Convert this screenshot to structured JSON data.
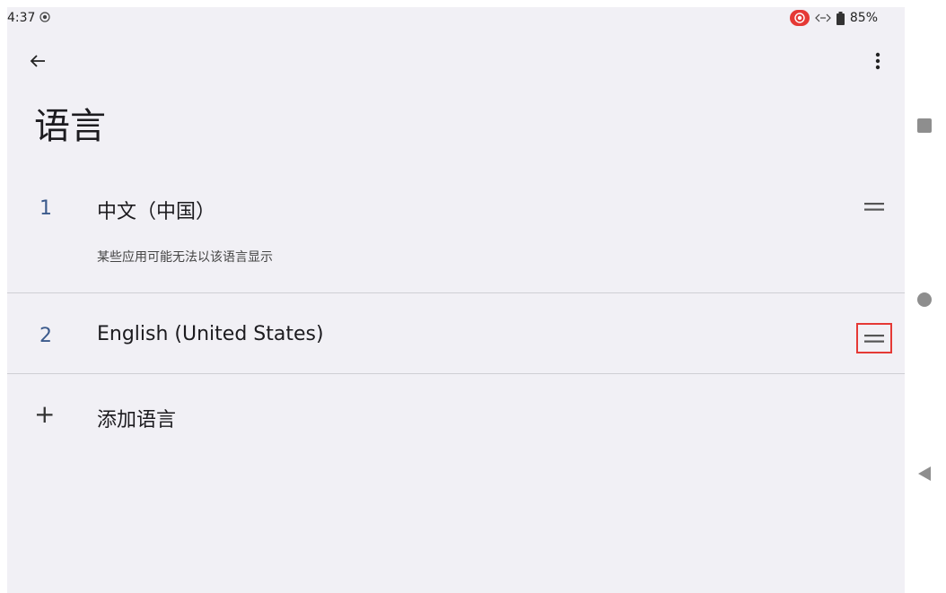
{
  "status_bar": {
    "time": "4:37",
    "battery": "85%",
    "icons": [
      "screen-record-icon",
      "data-sync-icon",
      "battery-icon"
    ]
  },
  "toolbar": {
    "back_icon": "arrow-back-icon",
    "more_icon": "more-vert-icon"
  },
  "page": {
    "title": "语言"
  },
  "languages": [
    {
      "number": "1",
      "name": "中文（中国）",
      "note": "某些应用可能无法以该语言显示"
    },
    {
      "number": "2",
      "name": "English (United States)",
      "note": ""
    }
  ],
  "add_language": {
    "icon": "+",
    "label": "添加语言"
  },
  "nav_bar": {
    "buttons": [
      "recents-square-icon",
      "home-circle-icon",
      "back-triangle-icon"
    ]
  },
  "colors": {
    "background": "#f1f0f5",
    "number_accent": "#3b5a8c",
    "highlight_box": "#e53935"
  }
}
